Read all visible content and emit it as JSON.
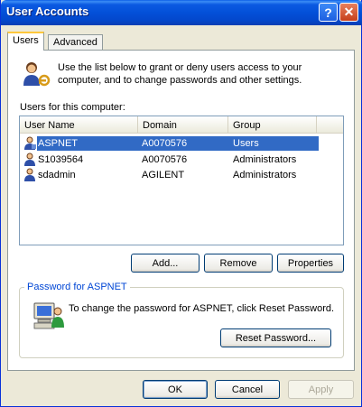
{
  "window": {
    "title": "User Accounts"
  },
  "titlebar": {
    "help_glyph": "?",
    "close_glyph": "✕"
  },
  "tabs": [
    {
      "label": "Users",
      "active": true
    },
    {
      "label": "Advanced",
      "active": false
    }
  ],
  "intro": {
    "icon": "users-keys-icon",
    "text": "Use the list below to grant or deny users access to your computer, and to change passwords and other settings."
  },
  "users_list": {
    "label": "Users for this computer:",
    "columns": [
      "User Name",
      "Domain",
      "Group"
    ],
    "rows": [
      {
        "name": "ASPNET",
        "domain": "A0070576",
        "group": "Users",
        "selected": true
      },
      {
        "name": "S1039564",
        "domain": "A0070576",
        "group": "Administrators",
        "selected": false
      },
      {
        "name": "sdadmin",
        "domain": "AGILENT",
        "group": "Administrators",
        "selected": false
      }
    ]
  },
  "list_buttons": {
    "add": "Add...",
    "remove": "Remove",
    "properties": "Properties"
  },
  "password_group": {
    "label": "Password for ASPNET",
    "icon": "computer-user-icon",
    "text": "To change the password for ASPNET, click Reset Password.",
    "reset_button": "Reset Password..."
  },
  "dialog_buttons": {
    "ok": "OK",
    "cancel": "Cancel",
    "apply": "Apply"
  },
  "colors": {
    "title_bar": "#0350D8",
    "selection": "#316AC5",
    "group_label": "#0046D5",
    "window_bg": "#ECE9D8"
  }
}
